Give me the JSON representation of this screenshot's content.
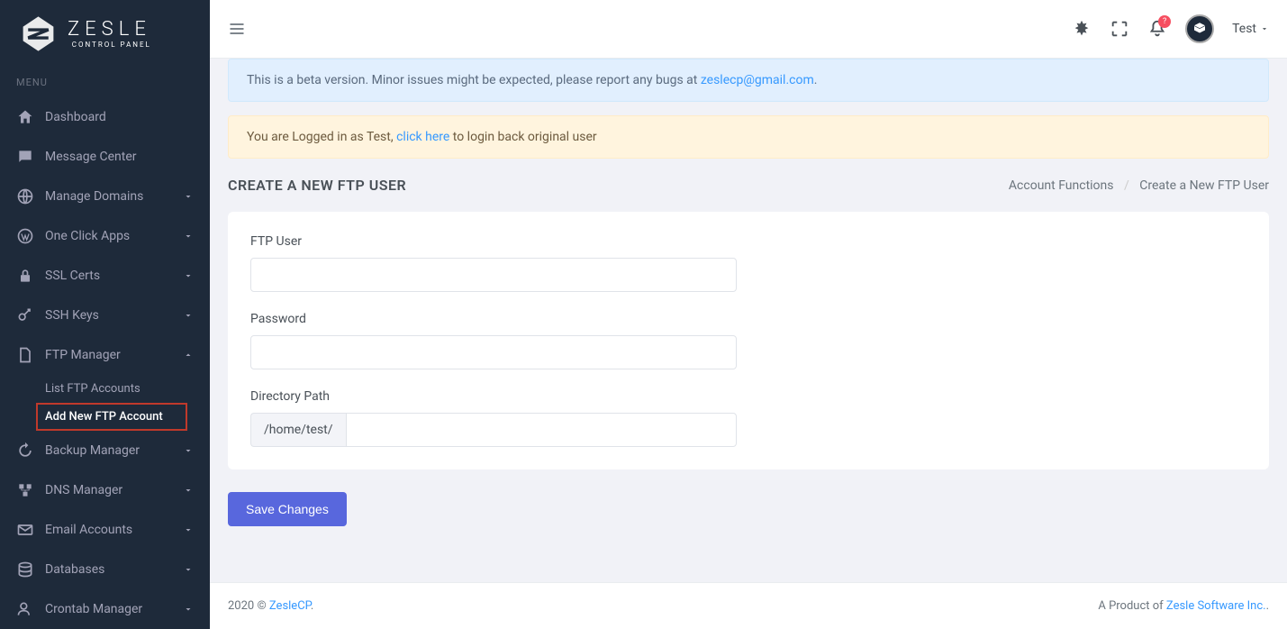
{
  "logo": {
    "main": "ZESLE",
    "sub": "CONTROL PANEL"
  },
  "menu_label": "MENU",
  "sidebar": {
    "dashboard": "Dashboard",
    "message_center": "Message Center",
    "manage_domains": "Manage Domains",
    "one_click_apps": "One Click Apps",
    "ssl_certs": "SSL Certs",
    "ssh_keys": "SSH Keys",
    "ftp_manager": "FTP Manager",
    "ftp_list": "List FTP Accounts",
    "ftp_add": "Add New FTP Account",
    "backup_manager": "Backup Manager",
    "dns_manager": "DNS Manager",
    "email_accounts": "Email Accounts",
    "databases": "Databases",
    "crontab_manager": "Crontab Manager"
  },
  "topbar": {
    "user_name": "Test",
    "notification_badge": "?"
  },
  "alerts": {
    "beta_text": "This is a beta version. Minor issues might be expected, please report any bugs at ",
    "beta_email": "zeslecp@gmail.com",
    "login_prefix": "You are Logged in as Test, ",
    "login_link": "click here",
    "login_suffix": " to login back original user"
  },
  "page": {
    "title": "CREATE A NEW FTP USER",
    "breadcrumb_parent": "Account Functions",
    "breadcrumb_current": "Create a New FTP User"
  },
  "form": {
    "ftp_user_label": "FTP User",
    "password_label": "Password",
    "directory_label": "Directory Path",
    "directory_prefix": "/home/test/",
    "submit": "Save Changes"
  },
  "footer": {
    "left_prefix": "2020 © ",
    "left_link": "ZesleCP",
    "right_prefix": "A Product of ",
    "right_link": "Zesle Software Inc."
  }
}
